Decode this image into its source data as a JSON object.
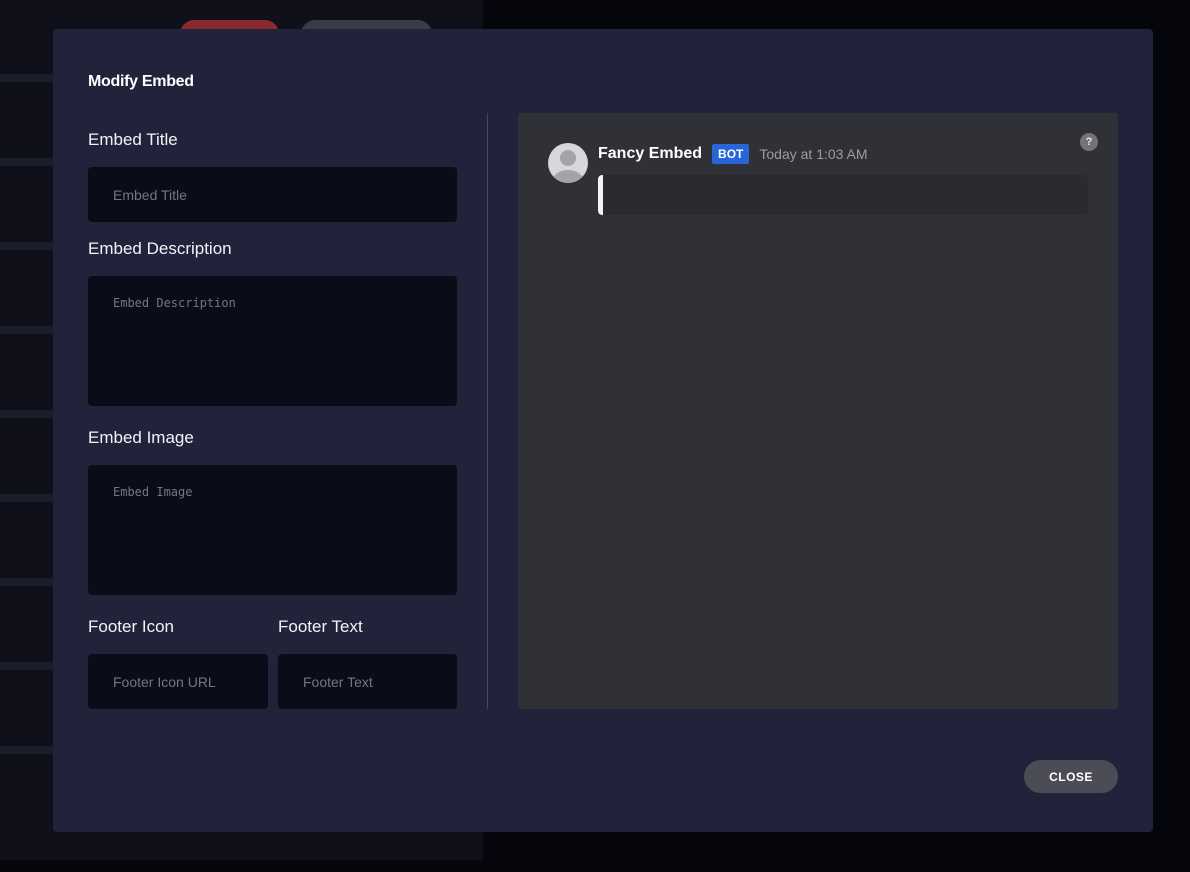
{
  "modal": {
    "title": "Modify Embed",
    "close_label": "CLOSE"
  },
  "form": {
    "title_label": "Embed Title",
    "title_placeholder": "Embed Title",
    "title_value": "",
    "description_label": "Embed Description",
    "description_placeholder": "Embed Description",
    "description_value": "",
    "image_label": "Embed Image",
    "image_placeholder": "Embed Image",
    "image_value": "",
    "footer_icon_label": "Footer Icon",
    "footer_icon_placeholder": "Footer Icon URL",
    "footer_icon_value": "",
    "footer_text_label": "Footer Text",
    "footer_text_placeholder": "Footer Text",
    "footer_text_value": ""
  },
  "preview": {
    "username": "Fancy Embed",
    "badge": "BOT",
    "timestamp": "Today at 1:03 AM",
    "help_icon": "?",
    "embed_color": "#f4f4f6"
  }
}
